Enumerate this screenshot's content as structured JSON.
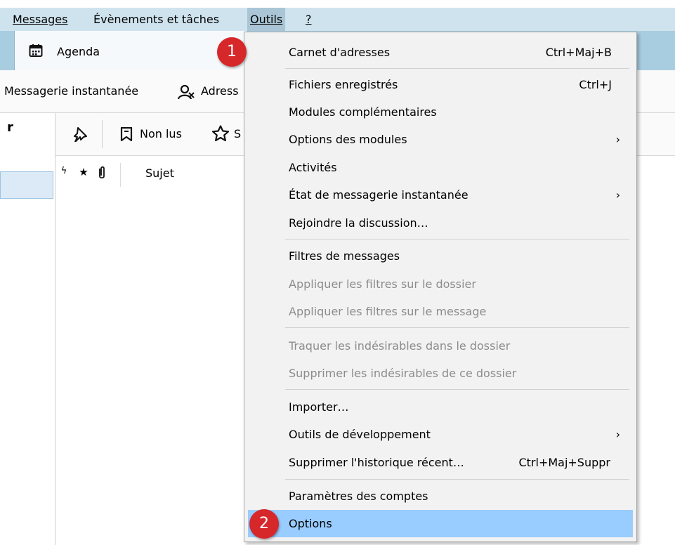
{
  "menubar": {
    "items": [
      {
        "label": "Messages",
        "underline_index": 0
      },
      {
        "label": "Évènements et tâches",
        "underline_index": 1
      },
      {
        "label": "Outils",
        "underline_index": 0
      },
      {
        "label": "?",
        "underline_index": 0
      }
    ]
  },
  "tabs": {
    "agenda": {
      "label": "Agenda",
      "icon": "calendar-icon"
    }
  },
  "toolbar": {
    "instant_messaging": "Messagerie instantanée",
    "address_book": "Adress",
    "address_book_icon": "address-book-icon"
  },
  "message_toolbar": {
    "quick_filter_icon": "pin-icon",
    "unread_label": "Non lus",
    "starred_label": "S"
  },
  "message_list": {
    "columns": [
      "Sujet"
    ],
    "column_icons": [
      "thread-icon",
      "star-icon",
      "attachment-icon"
    ]
  },
  "folder_pane": {
    "header": "r"
  },
  "dropdown": {
    "items": [
      {
        "label": "Carnet d'adresses",
        "shortcut": "Ctrl+Maj+B",
        "enabled": true
      },
      {
        "label": "Fichiers enregistrés",
        "shortcut": "Ctrl+J",
        "enabled": true
      },
      {
        "label": "Modules complémentaires",
        "enabled": true
      },
      {
        "label": "Options des modules",
        "submenu": true,
        "enabled": true
      },
      {
        "label": "Activités",
        "enabled": true
      },
      {
        "label": "État de messagerie instantanée",
        "submenu": true,
        "enabled": true
      },
      {
        "label": "Rejoindre la discussion…",
        "enabled": true
      },
      {
        "label": "Filtres de messages",
        "enabled": true
      },
      {
        "label": "Appliquer les filtres sur le dossier",
        "enabled": false
      },
      {
        "label": "Appliquer les filtres sur le message",
        "enabled": false
      },
      {
        "label": "Traquer les indésirables dans le dossier",
        "enabled": false
      },
      {
        "label": "Supprimer les indésirables de ce dossier",
        "enabled": false
      },
      {
        "label": "Importer…",
        "enabled": true
      },
      {
        "label": "Outils de développement",
        "submenu": true,
        "enabled": true
      },
      {
        "label": "Supprimer l'historique récent…",
        "shortcut": "Ctrl+Maj+Suppr",
        "enabled": true
      },
      {
        "label": "Paramètres des comptes",
        "enabled": true
      },
      {
        "label": "Options",
        "enabled": true,
        "highlighted": true
      }
    ],
    "submenu_arrow": "›"
  },
  "callouts": [
    "1",
    "2"
  ],
  "colors": {
    "menubar_bg": "#cfe3ee",
    "tabbar_bg": "#a9cde0",
    "menu_bg": "#f2f2f2",
    "highlight": "#99ccff",
    "callout": "#d6272b",
    "disabled_text": "#8c8c8c"
  }
}
